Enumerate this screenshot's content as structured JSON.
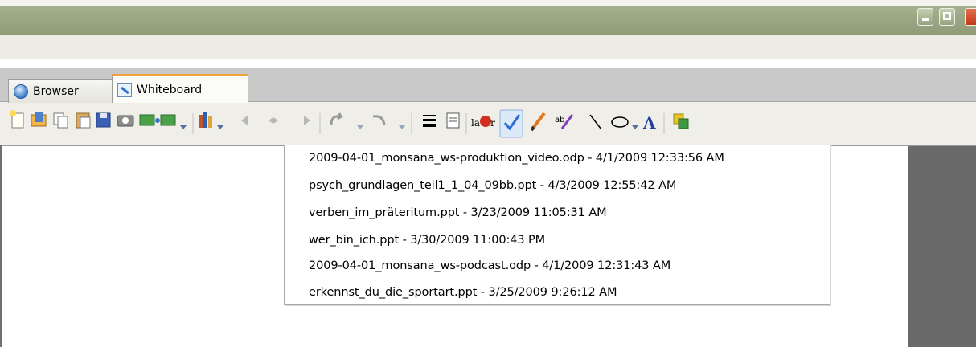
{
  "tabs": [
    {
      "label": "Browser",
      "icon": "globe-icon",
      "active": false
    },
    {
      "label": "Whiteboard",
      "icon": "whiteboard-icon",
      "active": true
    }
  ],
  "toolbar": {
    "tools": [
      "new-icon",
      "open-icon",
      "copy-icon",
      "paste-icon",
      "save-icon",
      "snapshot-icon",
      "present-icon",
      "document-list-icon",
      "previous-icon",
      "navigate-icon",
      "next-icon",
      "undo-icon",
      "redo-icon",
      "line-width-icon",
      "document-icon",
      "laser-icon",
      "check-icon",
      "pen-icon",
      "highlighter-icon",
      "line-icon",
      "ellipse-icon",
      "text-icon",
      "sync-icon"
    ],
    "selected_tool": "check-icon"
  },
  "recent_documents": {
    "items": [
      "2009-04-01_monsana_ws-produktion_video.odp - 4/1/2009 12:33:56 AM",
      "psych_grundlagen_teil1_1_04_09bb.ppt - 4/3/2009 12:55:42 AM",
      "verben_im_präteritum.ppt - 3/23/2009 11:05:31 AM",
      "wer_bin_ich.ppt - 3/30/2009 11:00:43 PM",
      "2009-04-01_monsana_ws-podcast.odp - 4/1/2009 12:31:43 AM",
      "erkennst_du_die_sportart.ppt - 3/25/2009 9:26:12 AM"
    ]
  },
  "colors": {
    "titlebar": "#8f9b77",
    "active_tab_accent": "#f2a23a",
    "selection": "#d9e8f7",
    "close_button": "#c23a18"
  }
}
